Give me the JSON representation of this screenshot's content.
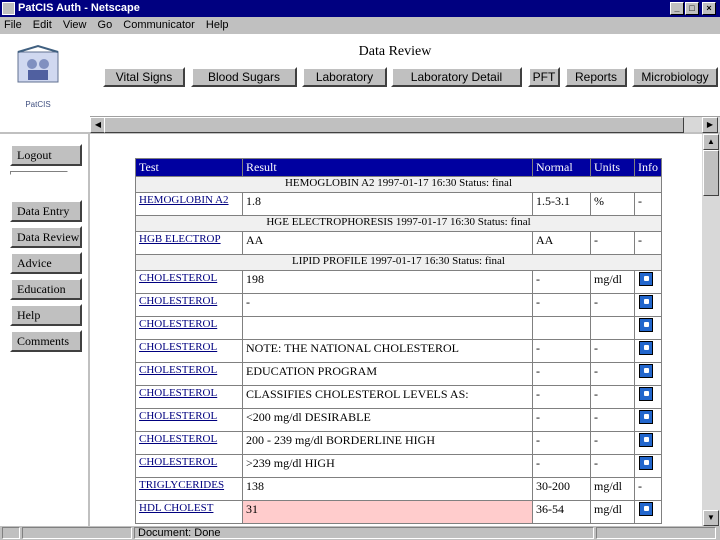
{
  "window": {
    "title": "PatCIS Auth - Netscape"
  },
  "menu": [
    "File",
    "Edit",
    "View",
    "Go",
    "Communicator",
    "Help"
  ],
  "header": {
    "logo_text": "PatCIS",
    "title": "Data Review",
    "nav": [
      "Vital Signs",
      "Blood Sugars",
      "Laboratory",
      "Laboratory Detail",
      "PFT",
      "Reports",
      "Microbiology"
    ]
  },
  "sidebar": {
    "logout": "Logout",
    "items": [
      "Data Entry",
      "Data Review",
      "Advice",
      "Education",
      "Help",
      "Comments"
    ]
  },
  "table": {
    "headers": [
      "Test",
      "Result",
      "Normal",
      "Units",
      "Info"
    ],
    "rows": [
      {
        "type": "section",
        "text": "HEMOGLOBIN A2 1997-01-17 16:30 Status: final"
      },
      {
        "type": "data",
        "test": "HEMOGLOBIN A2",
        "result": "1.8",
        "normal": "1.5-3.1",
        "units": "%",
        "info": "-"
      },
      {
        "type": "section",
        "text": "HGE ELECTROPHORESIS 1997-01-17 16:30 Status: final"
      },
      {
        "type": "data",
        "test": "HGB ELECTROP",
        "result": "AA",
        "normal": "AA",
        "units": "-",
        "info": "-"
      },
      {
        "type": "section",
        "text": "LIPID PROFILE 1997-01-17 16:30 Status: final"
      },
      {
        "type": "data",
        "test": "CHOLESTEROL",
        "result": "198",
        "normal": "-",
        "units": "mg/dl",
        "info": "icon"
      },
      {
        "type": "data",
        "test": "CHOLESTEROL",
        "result": "-",
        "normal": "-",
        "units": "-",
        "info": "icon"
      },
      {
        "type": "data",
        "test": "CHOLESTEROL",
        "result": "",
        "normal": "",
        "units": "",
        "info": "icon"
      },
      {
        "type": "data",
        "test": "CHOLESTEROL",
        "result": "NOTE: THE NATIONAL CHOLESTEROL",
        "normal": "-",
        "units": "-",
        "info": "icon"
      },
      {
        "type": "data",
        "test": "CHOLESTEROL",
        "result": "EDUCATION PROGRAM",
        "normal": "-",
        "units": "-",
        "info": "icon"
      },
      {
        "type": "data",
        "test": "CHOLESTEROL",
        "result": "CLASSIFIES CHOLESTEROL LEVELS AS:",
        "normal": "-",
        "units": "-",
        "info": "icon"
      },
      {
        "type": "data",
        "test": "CHOLESTEROL",
        "result": "<200 mg/dl DESIRABLE",
        "normal": "-",
        "units": "-",
        "info": "icon"
      },
      {
        "type": "data",
        "test": "CHOLESTEROL",
        "result": "200 - 239 mg/dl BORDERLINE HIGH",
        "normal": "-",
        "units": "-",
        "info": "icon"
      },
      {
        "type": "data",
        "test": "CHOLESTEROL",
        "result": ">239 mg/dl HIGH",
        "normal": "-",
        "units": "-",
        "info": "icon"
      },
      {
        "type": "data",
        "test": "TRIGLYCERIDES",
        "result": "138",
        "normal": "30-200",
        "units": "mg/dl",
        "info": "-"
      },
      {
        "type": "data",
        "test": "HDL CHOLEST",
        "result": "31",
        "normal": "36-54",
        "units": "mg/dl",
        "info": "icon",
        "highlight": true
      }
    ]
  },
  "status": {
    "text": "Document: Done"
  }
}
